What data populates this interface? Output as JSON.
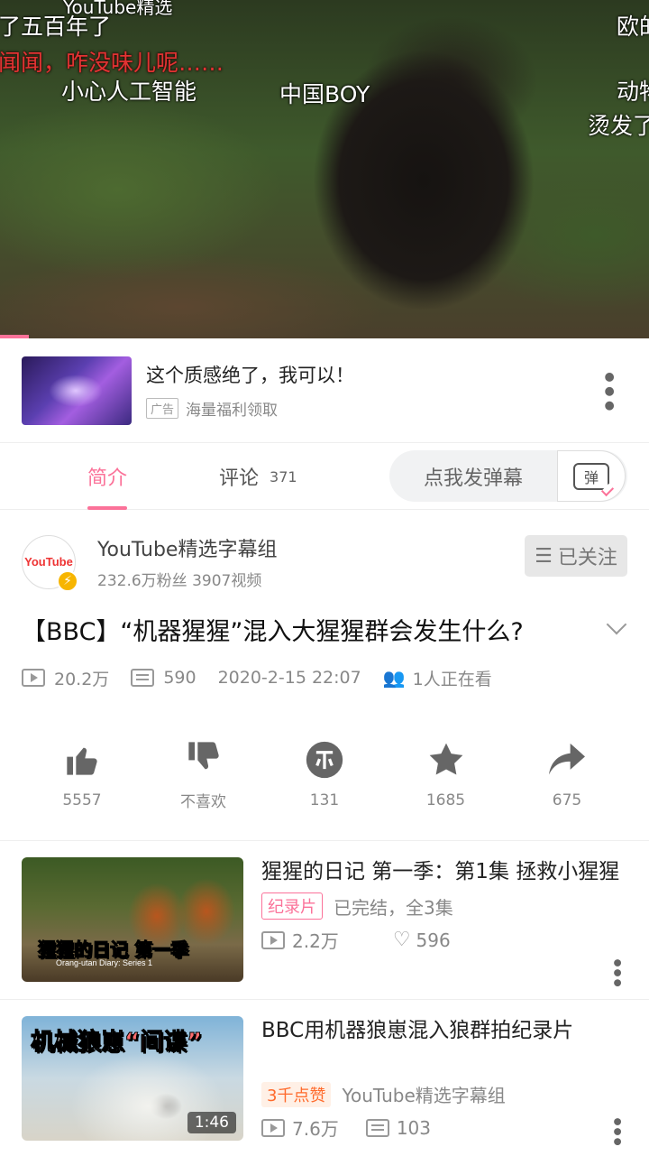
{
  "video": {
    "danmaku": [
      {
        "text": "YouTube精选",
        "red": false
      },
      {
        "text": "了五百年了",
        "red": false
      },
      {
        "text": "欧的",
        "red": false
      },
      {
        "text": "闻闻，咋没味儿呢……",
        "red": true
      },
      {
        "text": "小心人工智能",
        "red": false
      },
      {
        "text": "中国BOY",
        "red": false
      },
      {
        "text": "动物",
        "red": false
      },
      {
        "text": "烫发了",
        "red": false
      }
    ],
    "progress_fraction": 0.045
  },
  "ad": {
    "title": "这个质感绝了，我可以！",
    "tag": "广告",
    "subtitle": "海量福利领取"
  },
  "tabs": {
    "intro": "简介",
    "comments": "评论",
    "comment_count": "371",
    "danmaku_placeholder": "点我发弹幕",
    "danmaku_icon_char": "弹"
  },
  "uploader": {
    "avatar_text": "YouTube",
    "name": "YouTube精选字幕组",
    "stats": "232.6万粉丝  3907视频",
    "follow_label": "已关注"
  },
  "video_info": {
    "title": "【BBC】“机器猩猩”混入大猩猩群会发生什么?",
    "views": "20.2万",
    "danmaku_count": "590",
    "date": "2020-2-15 22:07",
    "watching": "1人正在看"
  },
  "actions": {
    "like": "5557",
    "dislike": "不喜欢",
    "coin": "131",
    "favorite": "1685",
    "share": "675"
  },
  "recommendations": [
    {
      "thumb_text": "猩猩的日记 第一季",
      "thumb_sub": "Orang-utan Diary: Series 1",
      "title": "猩猩的日记  第一季：第1集  拯救小猩猩",
      "tag": "纪录片",
      "extra": "已完结，全3集",
      "views": "2.2万",
      "likes": "596"
    },
    {
      "thumb_text_a": "机械狼崽",
      "thumb_text_b": "“间谍”",
      "duration": "1:46",
      "title": "BBC用机器狼崽混入狼群拍纪录片",
      "tag": "3千点赞",
      "extra": "YouTube精选字幕组",
      "views": "7.6万",
      "danmaku": "103"
    }
  ],
  "colors": {
    "accent": "#fb7299"
  }
}
